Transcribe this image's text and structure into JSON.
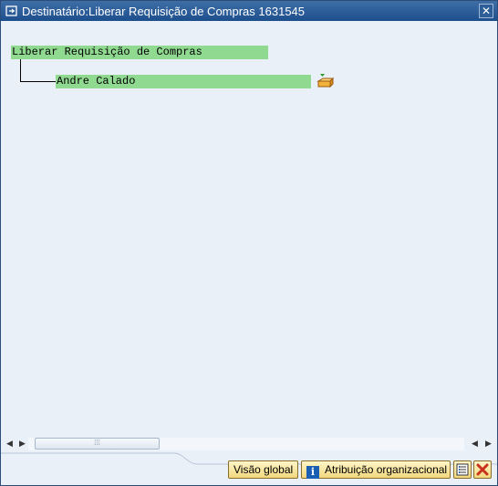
{
  "window": {
    "title": "Destinatário:Liberar Requisição de Compras 1631545"
  },
  "tree": {
    "root": {
      "label": "Liberar Requisição de Compras"
    },
    "child": {
      "label": "Andre Calado"
    }
  },
  "toolbar": {
    "global_view_label": "Visão global",
    "org_assignment_label": "Atribuição organizacional"
  },
  "icons": {
    "window": "window-menu-icon",
    "close": "close-icon",
    "node": "pencil-note-icon",
    "info": "info-icon",
    "list": "list-icon",
    "cancel": "cancel-icon"
  },
  "colors": {
    "node_highlight": "#90d990",
    "titlebar": "#1d4f8d",
    "button_face": "#f2d77e",
    "cancel": "#c8321e"
  }
}
